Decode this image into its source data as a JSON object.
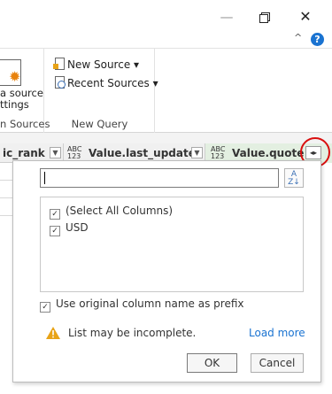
{
  "window": {
    "min_icon": "—",
    "close_icon": "✕"
  },
  "help": {
    "caret": "^",
    "icon": "?"
  },
  "ribbon": {
    "data_source": {
      "label_line1": "a source",
      "label_line2": "ttings",
      "group_label": "n Sources"
    },
    "new_query": {
      "new_source": "New Source ▾",
      "recent_sources": "Recent Sources ▾",
      "group_label": "New Query"
    }
  },
  "columns": {
    "c1": {
      "label": "ic_rank"
    },
    "c2": {
      "type": "ABC\n123",
      "label": "Value.last_updated"
    },
    "c3": {
      "type": "ABC\n123",
      "label": "Value.quote"
    }
  },
  "panel": {
    "search": {
      "value": ""
    },
    "sort_icon": "A\nZ↓",
    "items": [
      {
        "label": "(Select All Columns)",
        "checked": true
      },
      {
        "label": "USD",
        "checked": true
      }
    ],
    "prefix_label": "Use original column name as prefix",
    "warning": "List may be incomplete.",
    "load_more": "Load more",
    "ok": "OK",
    "cancel": "Cancel"
  },
  "colors": {
    "accent": "#1a73d1",
    "highlight": "#d90f0f",
    "column_selected": "#e3efe1",
    "warning": "#e8a317"
  }
}
